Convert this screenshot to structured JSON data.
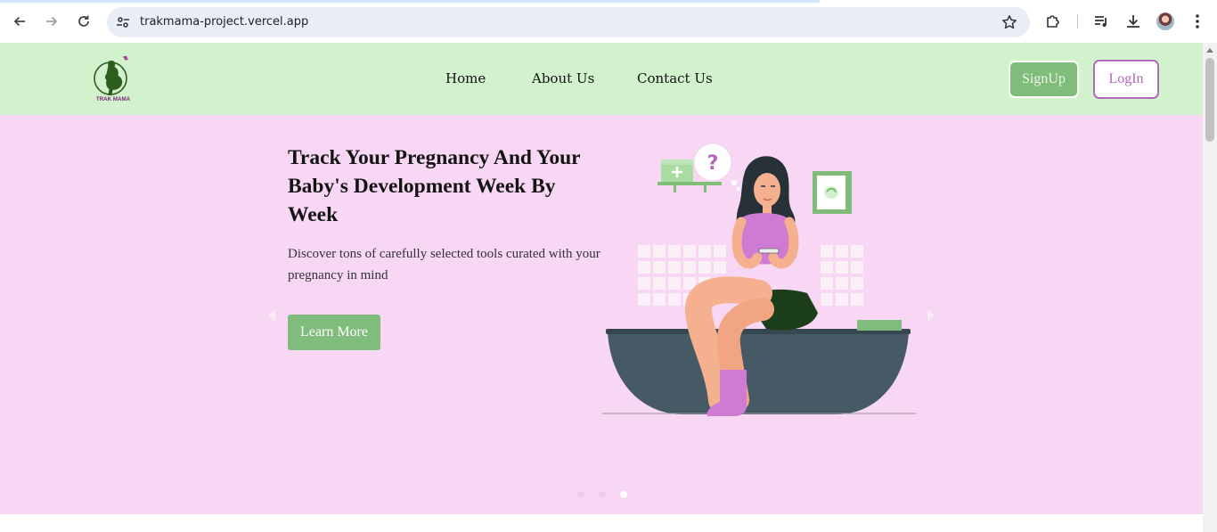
{
  "browser": {
    "url": "trakmama-project.vercel.app",
    "icons": [
      "back-arrow-icon",
      "forward-arrow-icon",
      "reload-icon",
      "site-settings-icon",
      "bookmark-star-icon",
      "extensions-icon",
      "media-controls-icon",
      "download-icon",
      "profile-avatar",
      "more-menu-icon"
    ]
  },
  "header": {
    "logo_text": "TRAK MAMA",
    "nav": [
      {
        "label": "Home"
      },
      {
        "label": "About Us"
      },
      {
        "label": "Contact Us"
      }
    ],
    "signup_label": "SignUp",
    "login_label": "LogIn"
  },
  "hero": {
    "title": "Track Your Pregnancy And Your Baby's Development Week By Week",
    "subtitle": "Discover tons of carefully selected tools curated with your pregnancy in mind",
    "cta_label": "Learn More",
    "slides_total": 3,
    "active_slide": 3
  },
  "colors": {
    "header_bg": "#d2f2ce",
    "hero_bg": "#f8d7f4",
    "accent_green": "#80bc7b",
    "accent_purple": "#b468b8"
  }
}
